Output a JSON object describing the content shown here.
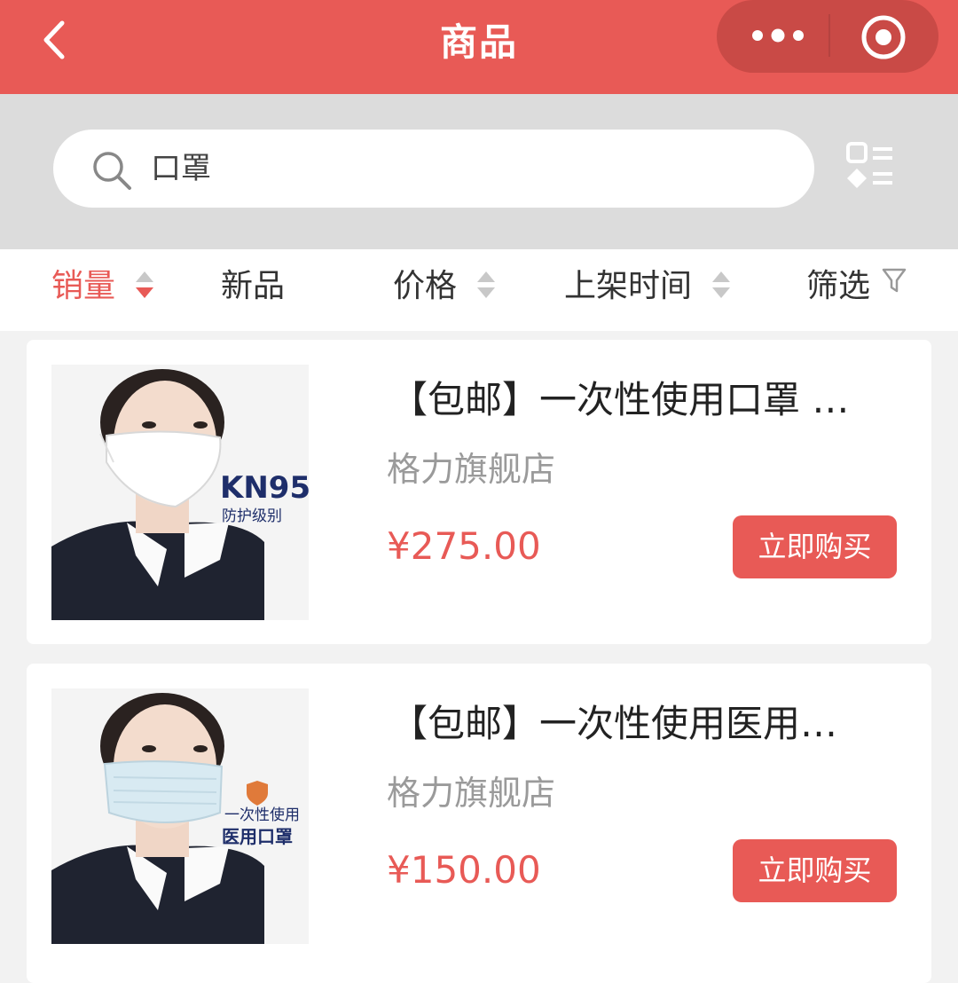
{
  "header": {
    "title": "商品",
    "back_icon": "chevron-left-icon",
    "more_icon": "more-dots-icon",
    "close_icon": "target-close-icon"
  },
  "search": {
    "value": "口罩",
    "icon": "search-icon"
  },
  "layout_toggle_icon": "grid-list-toggle-icon",
  "sort_tabs": [
    {
      "label": "销量",
      "active": true
    },
    {
      "label": "新品"
    },
    {
      "label": "价格"
    },
    {
      "label": "上架时间"
    },
    {
      "label": "筛选"
    }
  ],
  "products": [
    {
      "title": "【包邮】一次性使用口罩 …",
      "shop": "格力旗舰店",
      "price": "¥275.00",
      "button": "立即购买",
      "image_badge": "KN95",
      "image_sub": "防护级别"
    },
    {
      "title": "【包邮】一次性使用医用…",
      "shop": "格力旗舰店",
      "price": "¥150.00",
      "button": "立即购买",
      "image_badge": "一次性使用",
      "image_sub": "医用口罩"
    }
  ],
  "colors": {
    "accent": "#e85a56",
    "header_capsule": "#c94a46",
    "search_bg": "#dcdcdc"
  }
}
